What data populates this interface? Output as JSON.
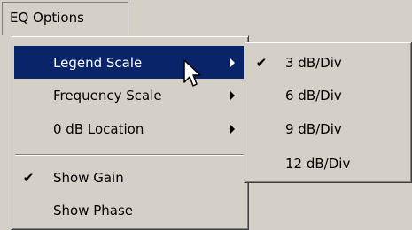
{
  "menubar": {
    "title": "EQ Options"
  },
  "main_menu": {
    "items": [
      {
        "label": "Legend Scale"
      },
      {
        "label": "Frequency Scale"
      },
      {
        "label": "0 dB Location"
      },
      {
        "label": "Show Gain",
        "check": "✔"
      },
      {
        "label": "Show Phase"
      }
    ]
  },
  "sub_menu": {
    "items": [
      {
        "label": "3 dB/Div",
        "check": "✔"
      },
      {
        "label": "6 dB/Div"
      },
      {
        "label": "9 dB/Div"
      },
      {
        "label": "12 dB/Div"
      }
    ]
  },
  "icons": {
    "submenu_arrow": "triangle-right",
    "checkmark": "check",
    "cursor": "arrow-pointer"
  },
  "colors": {
    "menu_background": "#d4d0c8",
    "highlight": "#0a246a",
    "highlight_text": "#ffffff"
  }
}
